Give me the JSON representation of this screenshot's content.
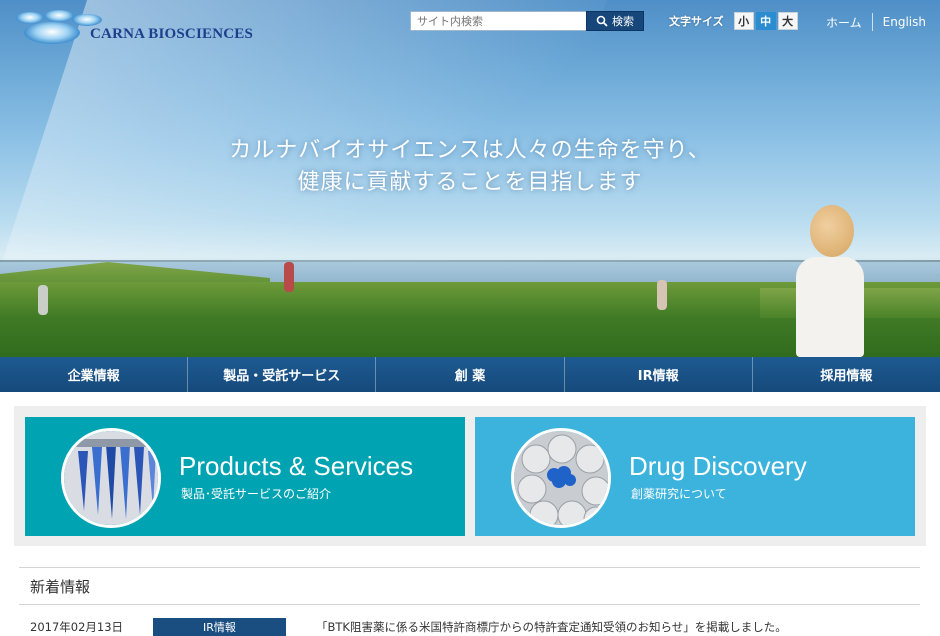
{
  "header": {
    "logo_text": "CARNA BIOSCIENCES",
    "search": {
      "placeholder": "サイト内検索",
      "button_label": "検索",
      "icon": "search-icon"
    },
    "font_size": {
      "label": "文字サイズ",
      "options": [
        "小",
        "中",
        "大"
      ],
      "selected": "中"
    },
    "links": {
      "home": "ホーム",
      "english": "English"
    }
  },
  "hero": {
    "tagline_line1": "カルナバイオサイエンスは人々の生命を守り、",
    "tagline_line2": "健康に貢献することを目指します"
  },
  "nav": {
    "items": [
      "企業情報",
      "製品・受託サービス",
      "創 薬",
      "IR情報",
      "採用情報"
    ]
  },
  "features": {
    "products": {
      "title": "Products & Services",
      "subtitle": "製品･受託サービスのご紹介",
      "color": "#00a3b1"
    },
    "drug": {
      "title": "Drug Discovery",
      "subtitle": "創薬研究について",
      "color": "#3bb3dd"
    }
  },
  "news": {
    "heading": "新着情報",
    "items": [
      {
        "date": "2017年02月13日",
        "category": "IR情報",
        "text": "「BTK阻害薬に係る米国特許商標庁からの特許査定通知受領のお知らせ」を掲載しました。"
      }
    ]
  }
}
